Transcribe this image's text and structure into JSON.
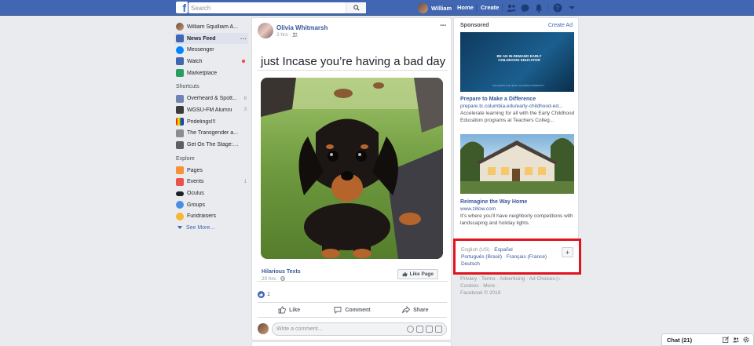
{
  "topbar": {
    "logo": "f",
    "search_placeholder": "Search",
    "user_name": "William",
    "home_label": "Home",
    "create_label": "Create"
  },
  "left_nav": {
    "profile_name": "William Squilliam A...",
    "main_items": [
      {
        "label": "News Feed",
        "icon": "news-feed-icon",
        "color": "#4267b2"
      },
      {
        "label": "Messenger",
        "icon": "messenger-icon",
        "color": "#0084ff"
      },
      {
        "label": "Watch",
        "icon": "watch-icon",
        "color": "#4267b2"
      },
      {
        "label": "Marketplace",
        "icon": "marketplace-icon",
        "color": "#2a9d63"
      }
    ],
    "shortcuts_heading": "Shortcuts",
    "shortcuts": [
      {
        "label": "Overheard & Spott...",
        "count": "8"
      },
      {
        "label": "WGSU-FM Alumni",
        "count": "3"
      },
      {
        "label": "Pridelings!!!",
        "count": ""
      },
      {
        "label": "The Transgender a...",
        "count": ""
      },
      {
        "label": "Get On The Stage: ...",
        "count": ""
      }
    ],
    "explore_heading": "Explore",
    "explore": [
      {
        "label": "Pages",
        "count": "",
        "color": "#f7923b"
      },
      {
        "label": "Events",
        "count": "1",
        "color": "#e9544f"
      },
      {
        "label": "Oculus",
        "count": "",
        "color": "#1d2129"
      },
      {
        "label": "Groups",
        "count": "",
        "color": "#4a90e2"
      },
      {
        "label": "Fundraisers",
        "count": "",
        "color": "#f5b731"
      }
    ],
    "see_more": "See More..."
  },
  "post": {
    "author": "Olivia Whitmarsh",
    "time": "2 hrs · ",
    "text": "just Incase you’re having a bad day",
    "link_source": "Hilarious Texts",
    "link_time": "20 hrs · ",
    "like_page_label": "Like Page",
    "reaction_count": "1",
    "actions": {
      "like": "Like",
      "comment": "Comment",
      "share": "Share"
    },
    "comment_placeholder": "Write a comment..."
  },
  "sponsored": {
    "heading": "Sponsored",
    "create_ad": "Create Ad",
    "ads": [
      {
        "image_text": "BE AN IN-DEMAND EARLY CHILDHOOD EDUCATOR",
        "image_subtext": "TEACHERS COLLEGE COLUMBIA UNIVERSITY",
        "title": "Prepare to Make a Difference",
        "url": "prepare.tc.columbia.edu/early-childhood-ed...",
        "description": "Accelerate learning for all with the Early Childhood Education programs at Teachers Colleg..."
      },
      {
        "title": "Reimagine the Way Home",
        "url": "www.zillow.com",
        "description": "It’s where you’ll have neighborly competitions with landscaping and holiday lights."
      }
    ]
  },
  "languages": {
    "current": "English (US)",
    "options": [
      "Español",
      "Português (Brasil)",
      "Français (France)",
      "Deutsch"
    ],
    "highlight_color": "#e0141e"
  },
  "footer": {
    "links": [
      "Privacy",
      "Terms",
      "Advertising",
      "Ad Choices",
      "Cookies",
      "More"
    ],
    "copyright": "Facebook © 2019"
  },
  "chat": {
    "label": "Chat (21)"
  },
  "colors": {
    "brand": "#4267b2",
    "link": "#385898",
    "background": "#e9ebee"
  }
}
